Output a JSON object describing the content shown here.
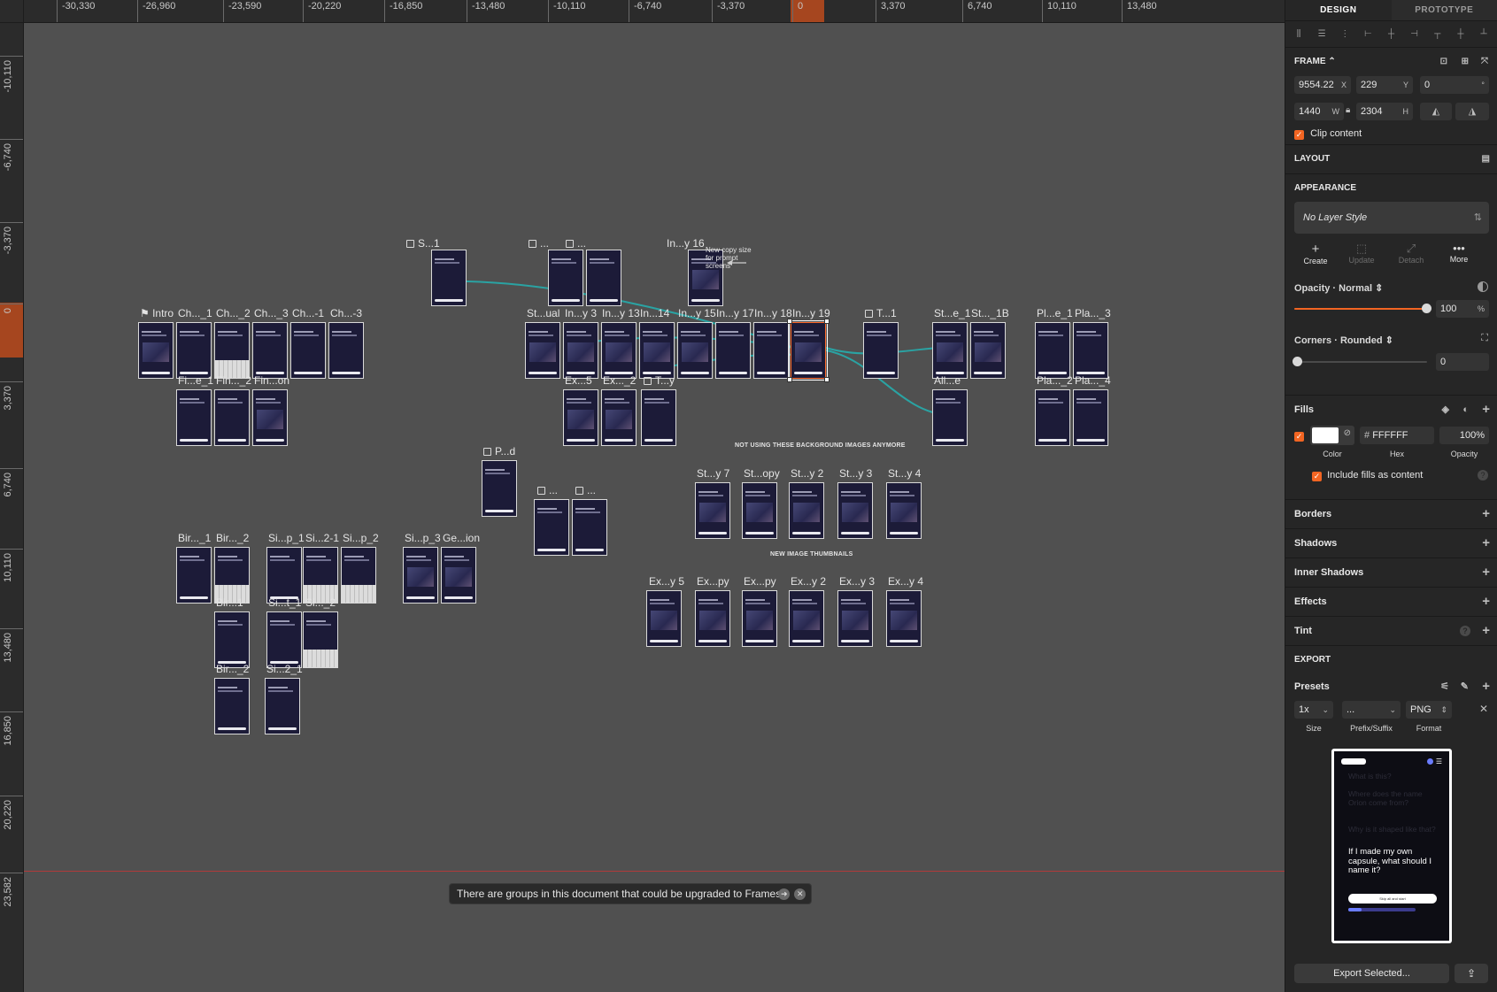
{
  "ruler": {
    "top": [
      "-30,330",
      "-26,960",
      "-23,590",
      "-20,220",
      "-16,850",
      "-13,480",
      "-10,110",
      "-6,740",
      "-3,370",
      "0",
      "3,370",
      "6,740",
      "10,110",
      "13,480"
    ],
    "left": [
      "-10,110",
      "-6,740",
      "-3,370",
      "0",
      "3,370",
      "6,740",
      "10,110",
      "13,480",
      "16,850",
      "20,220",
      "23,582"
    ]
  },
  "canvas": {
    "labels": {
      "s1": "S...1",
      "dots_a": "...",
      "dots_b": "...",
      "inquiry16": "In...y 16",
      "intro": "Intro",
      "ch1": "Ch..._1",
      "ch2": "Ch..._2",
      "ch3": "Ch..._3",
      "chm1": "Ch...-1",
      "chm3": "Ch...-3",
      "stual": "St...ual",
      "iny3": "In...y 3",
      "iny13": "In...y 13",
      "in14": "In...14",
      "iny15": "In...y 15",
      "iny17": "In...y 17",
      "iny18": "In...y 18",
      "iny19": "In...y 19",
      "t1": "T...1",
      "ste1": "St...e_1",
      "st1b": "St..._1B",
      "ple1": "Pl...e_1",
      "pla3": "Pla..._3",
      "fie1": "Fi...e_1",
      "fin2": "Fin..._2",
      "finon": "Fin...on",
      "ex5": "Ex...5",
      "ex2": "Ex..._2",
      "ty": "T...y",
      "alle": "All...e",
      "pla2": "Pla..._2",
      "pla4": "Pla..._4",
      "pd": "P...d",
      "dots_c": "...",
      "dots_d": "...",
      "sty7": "St...y 7",
      "stopy": "St...opy",
      "sty2": "St...y 2",
      "sty3": "St...y 3",
      "sty4": "St...y 4",
      "bir1": "Bir..._1",
      "bir2": "Bir..._2",
      "sip1": "Si...p_1",
      "si21": "Si...2-1",
      "sip2": "Si...p_2",
      "sip3": "Si...p_3",
      "geion": "Ge...ion",
      "bir1b": "Bir...1",
      "sit1": "Si...t_1",
      "si2b": "Si..._2",
      "bir2b": "Bir..._2",
      "si21b": "Si...2_1",
      "exy5": "Ex...y 5",
      "expy": "Ex...py",
      "expy2": "Ex...py",
      "exy2": "Ex...y 2",
      "exy3": "Ex...y 3",
      "exy4": "Ex...y 4"
    },
    "notes": {
      "copy_size": "New copy size for prompt screens",
      "not_using": "NOT USING THESE BACKGROUND IMAGES ANYMORE",
      "new_image": "NEW IMAGE THUMBNAILS"
    },
    "toast": "There are groups in this document that could be upgraded to Frames"
  },
  "inspector": {
    "tabs": [
      "DESIGN",
      "PROTOTYPE"
    ],
    "frame": {
      "title": "FRAME",
      "x": "9554.22",
      "y": "229",
      "rotation": "0",
      "w": "1440",
      "h": "2304",
      "x_label": "X",
      "y_label": "Y",
      "w_label": "W",
      "h_label": "H",
      "deg": "°",
      "clip": "Clip content"
    },
    "layout_title": "LAYOUT",
    "appearance": {
      "title": "APPEARANCE",
      "style": "No Layer Style",
      "actions": [
        "Create",
        "Update",
        "Detach",
        "More"
      ],
      "opacity_label": "Opacity · Normal",
      "opacity_value": "100",
      "opacity_unit": "%",
      "opacity_level": 1.0,
      "corners_label": "Corners · Rounded",
      "corners_value": "0"
    },
    "fills": {
      "title": "Fills",
      "hex": "FFFFFF",
      "hash": "#",
      "opacity": "100%",
      "color_label": "Color",
      "hex_label": "Hex",
      "opacity_label": "Opacity",
      "include": "Include fills as content"
    },
    "rows": [
      "Borders",
      "Shadows",
      "Inner Shadows",
      "Effects",
      "Tint"
    ],
    "export": {
      "title": "EXPORT",
      "presets": "Presets",
      "size": "1x",
      "prefix": "...",
      "format": "PNG",
      "size_label": "Size",
      "prefix_label": "Prefix/Suffix",
      "format_label": "Format",
      "button": "Export Selected..."
    },
    "preview": {
      "faded": [
        "What is this?",
        "Where does the name Orion come from?",
        "Why is it shaped like that?"
      ],
      "main": "If I made my own capsule, what should I name it?",
      "button": "Skip all and start",
      "progress": 0.2
    }
  },
  "colors": {
    "accent": "#f26522",
    "connector": "#2aa3a3",
    "frame_bg": "#1c1b38"
  }
}
